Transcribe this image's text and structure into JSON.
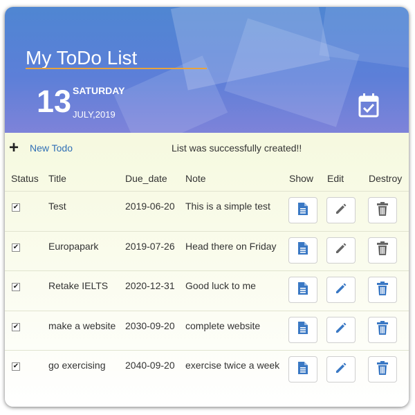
{
  "header": {
    "title": "My ToDo List",
    "day": "13",
    "weekday": "SATURDAY",
    "month_year": "JULY,2019",
    "calendar_icon": "calendar-check-icon"
  },
  "toolbar": {
    "new_todo_label": "New Todo",
    "flash_message": "List was successfully created!!"
  },
  "table": {
    "headers": [
      "Status",
      "Title",
      "Due_date",
      "Note",
      "Show",
      "Edit",
      "Destroy"
    ],
    "rows": [
      {
        "status": true,
        "title": "Test",
        "due_date": "2019-06-20",
        "note": "This is a simple test",
        "active": false
      },
      {
        "status": true,
        "title": "Europapark",
        "due_date": "2019-07-26",
        "note": "Head there on Friday",
        "active": false
      },
      {
        "status": true,
        "title": "Retake IELTS",
        "due_date": "2020-12-31",
        "note": "Good luck to me",
        "active": true
      },
      {
        "status": true,
        "title": "make a website",
        "due_date": "2030-09-20",
        "note": "complete website",
        "active": true
      },
      {
        "status": true,
        "title": "go exercising",
        "due_date": "2040-09-20",
        "note": "exercise twice a week",
        "active": true
      }
    ]
  },
  "colors": {
    "accent_blue": "#3a78c4",
    "disabled_gray": "#666666",
    "title_underline": "#e8a33d"
  },
  "icons": {
    "show": "document-icon",
    "edit": "pencil-icon",
    "destroy": "trash-icon",
    "new": "plus-icon",
    "status": "checkbox-icon"
  }
}
